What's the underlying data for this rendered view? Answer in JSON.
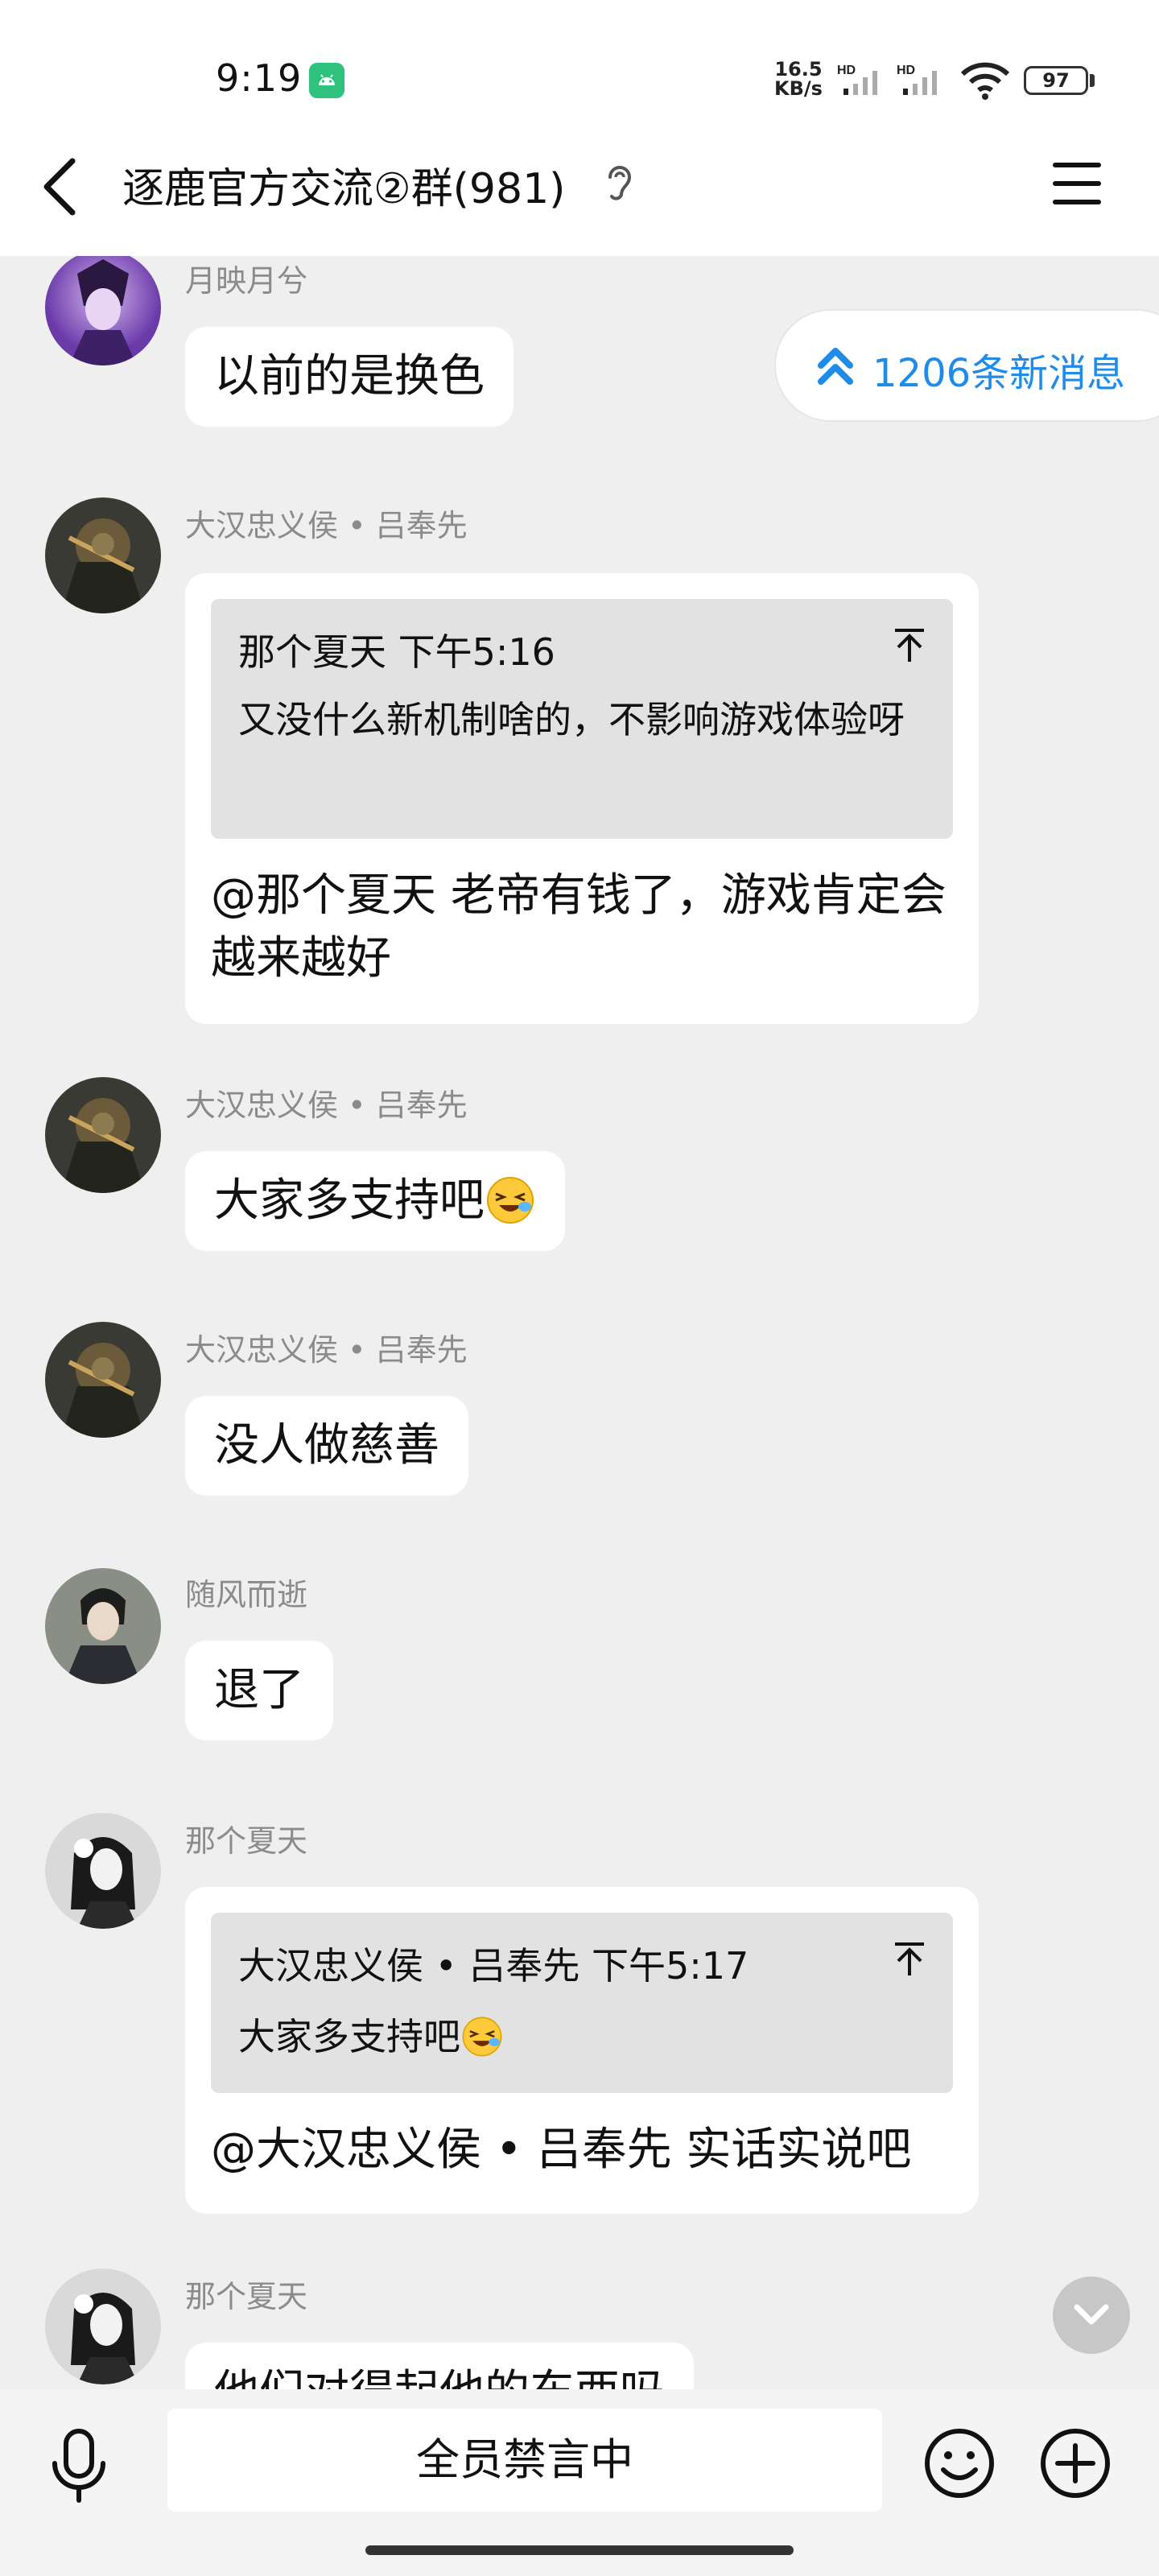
{
  "status_bar": {
    "time": "9:19",
    "net_speed_value": "16.5",
    "net_speed_unit": "KB/s",
    "hd1": "HD",
    "hd2": "HD",
    "battery": "97"
  },
  "header": {
    "title": "逐鹿官方交流②群(981)"
  },
  "new_messages": {
    "label": "1206条新消息"
  },
  "messages": [
    {
      "sender": "月映月兮",
      "text": "以前的是换色"
    },
    {
      "sender": "大汉忠义侯 • 吕奉先",
      "quote_head": "那个夏天  下午5:16",
      "quote_text": "又没什么新机制啥的，不影响游戏体验呀",
      "text": "@那个夏天 老帝有钱了，游戏肯定会越来越好"
    },
    {
      "sender": "大汉忠义侯 • 吕奉先",
      "text": "大家多支持吧",
      "emoji": "squint-grin-emoji"
    },
    {
      "sender": "大汉忠义侯 • 吕奉先",
      "text": "没人做慈善"
    },
    {
      "sender": "随风而逝",
      "text": "退了"
    },
    {
      "sender": "那个夏天",
      "quote_head": "大汉忠义侯 • 吕奉先  下午5:17",
      "quote_text": "大家多支持吧",
      "quote_emoji": "squint-grin-emoji",
      "text": "@大汉忠义侯 • 吕奉先 实话实说吧"
    },
    {
      "sender": "那个夏天",
      "text": "他们对得起他的东西吗"
    }
  ],
  "input_bar": {
    "muted_label": "全员禁言中"
  },
  "colors": {
    "accent": "#1e8ce8",
    "background": "#efefef",
    "bubble": "#ffffff",
    "quote_bg": "#e2e2e2"
  }
}
